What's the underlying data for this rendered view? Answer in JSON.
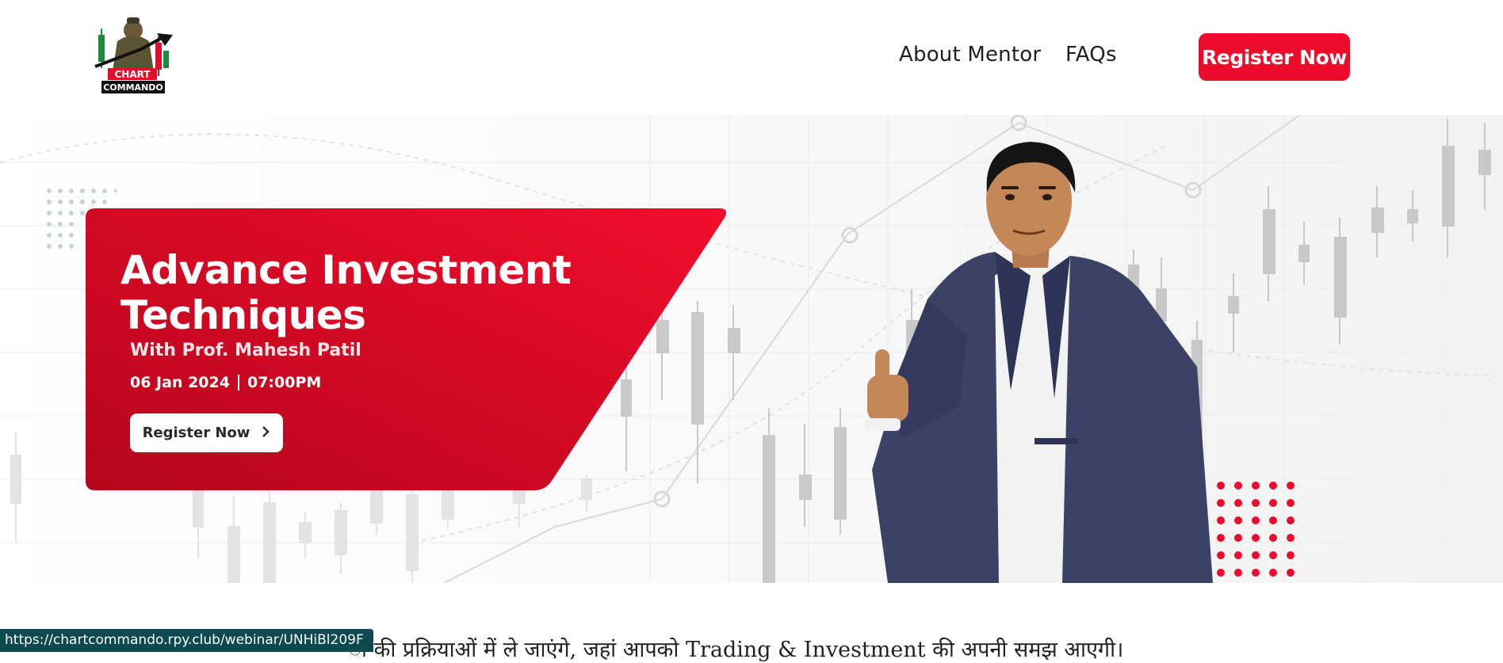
{
  "brand": {
    "logo_name": "chart-commando-logo",
    "logo_lines": [
      "CHART",
      "COMMANDO"
    ]
  },
  "nav": {
    "items": [
      {
        "label": "About Mentor"
      },
      {
        "label": "FAQs"
      }
    ],
    "cta_label": "Register Now"
  },
  "hero": {
    "title": "Advance Investment Techniques",
    "subtitle": "With Prof. Mahesh Patil",
    "date": "06 Jan 2024",
    "time": "07:00PM",
    "cta_label": "Register Now",
    "cta_icon": "chevron-right-icon"
  },
  "content": {
    "intro_line_partial": "ी की प्रक्रियाओं में ले जाएंगे, जहां आपको Trading & Investment की अपनी समझ आएगी।"
  },
  "status_bar": {
    "url": "https://chartcommando.rpy.club/webinar/UNHiBl209F"
  },
  "colors": {
    "brand_red": "#ec0b2a",
    "card_red_dark": "#b8061c",
    "status_bg": "#0c4a4f"
  }
}
